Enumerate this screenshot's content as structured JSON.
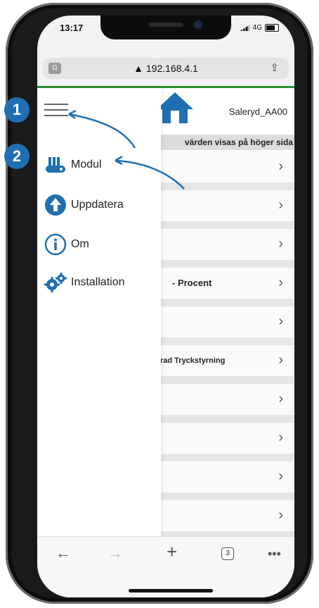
{
  "status_bar": {
    "time": "13:17",
    "network": "4G"
  },
  "url_bar": {
    "url": "▲ 192.168.4.1"
  },
  "header": {
    "device_name": "Saleryd_AA00"
  },
  "page": {
    "subheading": "värden visas på höger sida",
    "rows": [
      {
        "label": ""
      },
      {
        "label": ""
      },
      {
        "label": ""
      },
      {
        "label": "- Procent"
      },
      {
        "label": ""
      },
      {
        "label": "rad Tryckstyrning"
      },
      {
        "label": ""
      },
      {
        "label": ""
      },
      {
        "label": ""
      },
      {
        "label": ""
      }
    ]
  },
  "drawer": {
    "items": [
      {
        "label": "Modul",
        "icon": "module-icon"
      },
      {
        "label": "Uppdatera",
        "icon": "upload-icon"
      },
      {
        "label": "Om",
        "icon": "info-icon"
      },
      {
        "label": "Installation",
        "icon": "gears-icon"
      }
    ]
  },
  "bottom_bar": {
    "tab_count": "3"
  },
  "callouts": {
    "one": "1",
    "two": "2"
  },
  "colors": {
    "accent": "#1f6fb2",
    "header_line": "#2f8f2f"
  }
}
